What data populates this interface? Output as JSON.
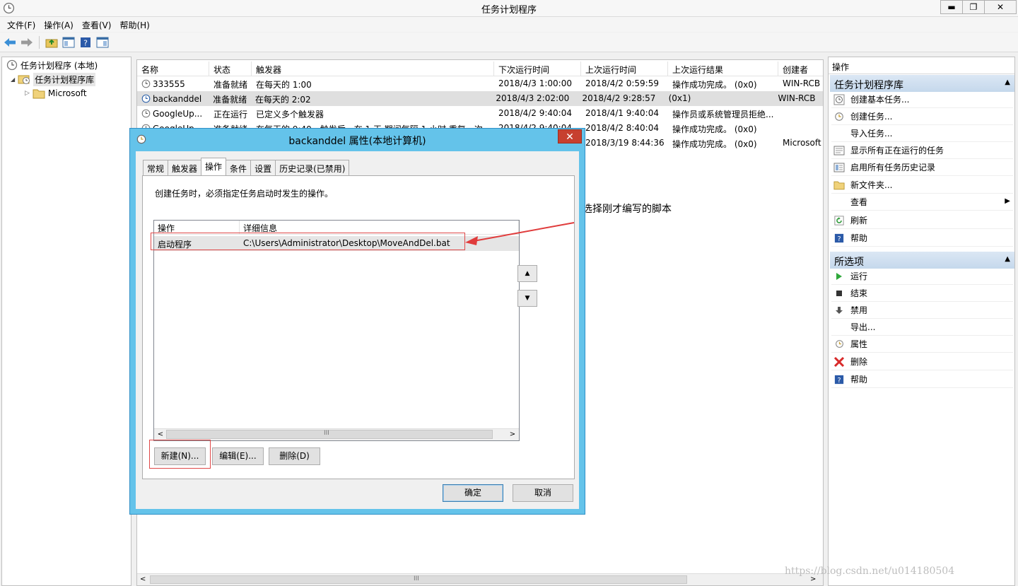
{
  "window": {
    "title": "任务计划程序",
    "min": "▬",
    "max": "❐",
    "close": "✕"
  },
  "menu": [
    "文件(F)",
    "操作(A)",
    "查看(V)",
    "帮助(H)"
  ],
  "tree": {
    "root": "任务计划程序 (本地)",
    "library": "任务计划程序库",
    "child": "Microsoft"
  },
  "task_list": {
    "columns": [
      "名称",
      "状态",
      "触发器",
      "下次运行时间",
      "上次运行时间",
      "上次运行结果",
      "创建者"
    ],
    "rows": [
      {
        "name": "333555",
        "status": "准备就绪",
        "trigger": "在每天的 1:00",
        "next": "2018/4/3 1:00:00",
        "last": "2018/4/2 0:59:59",
        "result": "操作成功完成。 (0x0)",
        "author": "WIN-RCB"
      },
      {
        "name": "backanddel",
        "status": "准备就绪",
        "trigger": "在每天的 2:02",
        "next": "2018/4/3 2:02:00",
        "last": "2018/4/2 9:28:57",
        "result": "(0x1)",
        "author": "WIN-RCB"
      },
      {
        "name": "GoogleUp...",
        "status": "正在运行",
        "trigger": "已定义多个触发器",
        "next": "2018/4/2 9:40:04",
        "last": "2018/4/1 9:40:04",
        "result": "操作员或系统管理员拒绝...",
        "author": ""
      },
      {
        "name": "GoogleUp...",
        "status": "准备就绪",
        "trigger": "在每天的 9:40 - 触发后，在 1 天 期间每隔 1 小时 重复一次。",
        "next": "2018/4/2 9:40:04",
        "last": "2018/4/2 8:40:04",
        "result": "操作成功完成。 (0x0)",
        "author": ""
      },
      {
        "name": "",
        "status": "",
        "trigger": "",
        "next": "",
        "last": "2018/3/19 8:44:36",
        "result": "操作成功完成。 (0x0)",
        "author": "Microsoft"
      }
    ],
    "scroll_mark": "III"
  },
  "actions": {
    "title": "操作",
    "section1": "任务计划程序库",
    "items1": [
      "创建基本任务...",
      "创建任务...",
      "导入任务...",
      "显示所有正在运行的任务",
      "启用所有任务历史记录",
      "新文件夹...",
      "查看",
      "刷新",
      "帮助"
    ],
    "section2": "所选项",
    "items2": [
      "运行",
      "结束",
      "禁用",
      "导出...",
      "属性",
      "删除",
      "帮助"
    ]
  },
  "annotation": "选择刚才编写的脚本",
  "watermark": "https://blog.csdn.net/u014180504",
  "dialog": {
    "title": "backanddel 属性(本地计算机)",
    "tabs": [
      "常规",
      "触发器",
      "操作",
      "条件",
      "设置",
      "历史记录(已禁用)"
    ],
    "active_tab": "操作",
    "description": "创建任务时，必须指定任务启动时发生的操作。",
    "columns": [
      "操作",
      "详细信息"
    ],
    "row": {
      "action": "启动程序",
      "detail": "C:\\Users\\Administrator\\Desktop\\MoveAndDel.bat"
    },
    "scroll_mark": "III",
    "up": "▲",
    "down": "▼",
    "new_btn": "新建(N)...",
    "edit_btn": "编辑(E)...",
    "delete_btn": "删除(D)",
    "ok_btn": "确定",
    "cancel_btn": "取消"
  }
}
